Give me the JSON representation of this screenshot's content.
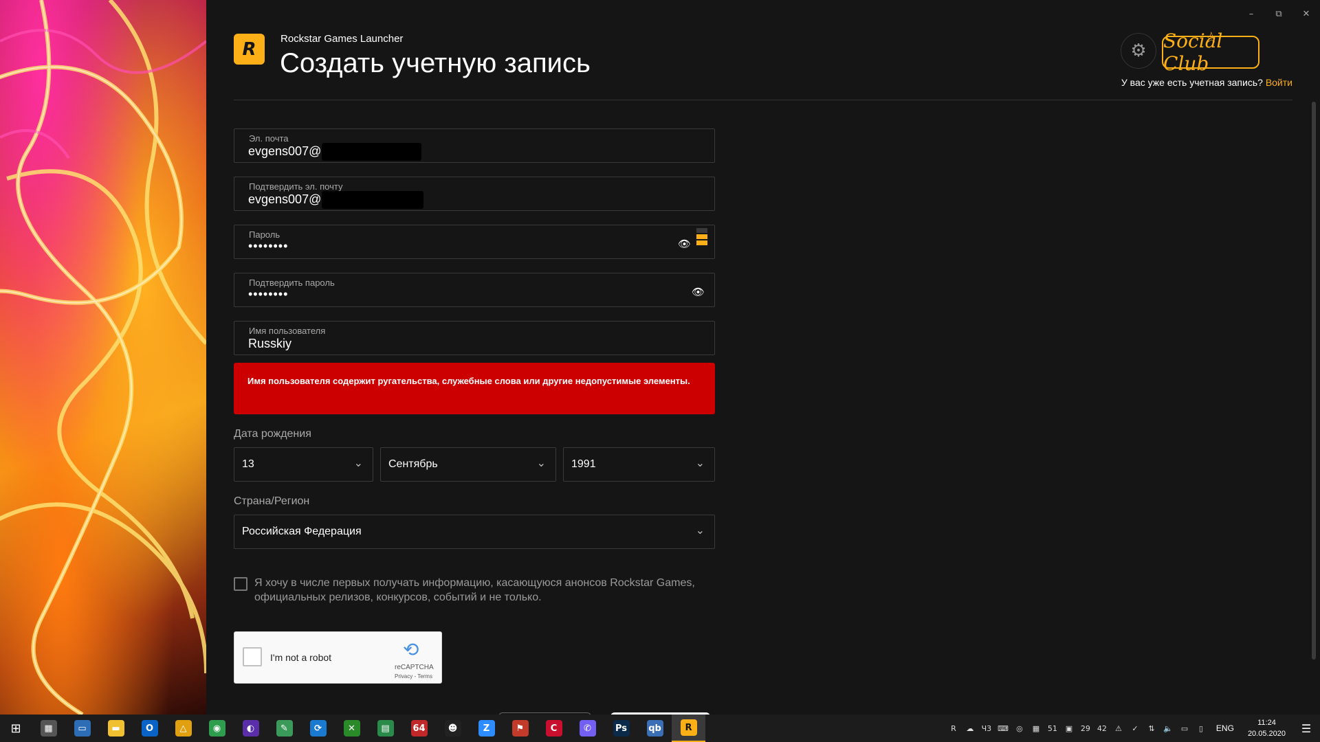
{
  "window": {
    "app_name": "Rockstar Games Launcher",
    "minimize_glyph": "–",
    "restore_glyph": "⧉",
    "close_glyph": "✕"
  },
  "header": {
    "logo_letter": "R",
    "title": "Создать учетную запись",
    "settings_icon": "⚙",
    "social_club_logo": "Social Club",
    "signin_prompt": "У вас уже есть учетная запись?",
    "signin_link": "Войти"
  },
  "form": {
    "email": {
      "label": "Эл. почта",
      "value": "evgens007@"
    },
    "confirm_email": {
      "label": "Подтвердить эл. почту",
      "value": "evgens007@"
    },
    "password": {
      "label": "Пароль",
      "value": "••••••••",
      "strength_level": 2,
      "strength_max": 3
    },
    "confirm_password": {
      "label": "Подтвердить пароль",
      "value": "••••••••"
    },
    "username": {
      "label": "Имя пользователя",
      "value": "Russkiy"
    },
    "error_message": "Имя пользователя содержит ругательства, служебные слова или другие недопустимые элементы.",
    "dob_label": "Дата рождения",
    "dob_day": "13",
    "dob_month": "Сентябрь",
    "dob_year": "1991",
    "country_label": "Страна/Регион",
    "country_value": "Российская Федерация",
    "newsletter_text": "Я хочу в числе первых получать информацию, касающуюся анонсов Rockstar Games, официальных релизов, конкурсов, событий и не только.",
    "newsletter_checked": false
  },
  "captcha": {
    "label": "I'm not a robot",
    "brand": "reCAPTCHA",
    "links": "Privacy - Terms"
  },
  "taskbar": {
    "pinned": [
      {
        "name": "calculator",
        "glyph": "▦",
        "color": "#555"
      },
      {
        "name": "remote-desktop",
        "glyph": "▭",
        "color": "#2d6db5"
      },
      {
        "name": "file-explorer",
        "glyph": "▬",
        "color": "#f0c030"
      },
      {
        "name": "outlook",
        "glyph": "O",
        "color": "#0a64c8"
      },
      {
        "name": "triangle-app",
        "glyph": "△",
        "color": "#e0a010"
      },
      {
        "name": "chrome",
        "glyph": "◉",
        "color": "#2e9e4e"
      },
      {
        "name": "purple-app",
        "glyph": "◐",
        "color": "#5a2ea8"
      },
      {
        "name": "paint-app",
        "glyph": "✎",
        "color": "#3a9a5a"
      },
      {
        "name": "sync-app",
        "glyph": "⟳",
        "color": "#1a7ad0"
      },
      {
        "name": "xbox",
        "glyph": "✕",
        "color": "#2a8a2a"
      },
      {
        "name": "green-app",
        "glyph": "▤",
        "color": "#2a8a4a"
      },
      {
        "name": "app-64",
        "glyph": "64",
        "color": "#c0282a"
      },
      {
        "name": "mask-app",
        "glyph": "☻",
        "color": "#222"
      },
      {
        "name": "zoom",
        "glyph": "Z",
        "color": "#2d8cff"
      },
      {
        "name": "filezilla",
        "glyph": "⚑",
        "color": "#c23a2a"
      },
      {
        "name": "red-c-app",
        "glyph": "C",
        "color": "#c8102e"
      },
      {
        "name": "viber",
        "glyph": "✆",
        "color": "#7360f2"
      },
      {
        "name": "photoshop",
        "glyph": "Ps",
        "color": "#0b2a4a"
      },
      {
        "name": "qbittorrent",
        "glyph": "qb",
        "color": "#3a6fb5"
      },
      {
        "name": "rockstar-launcher",
        "glyph": "R",
        "color": "#fcaf17"
      }
    ],
    "tray_labels": [
      "R",
      "☁",
      "Ч3",
      "⌨",
      "◎",
      "▦",
      "51",
      "▣",
      "29",
      "42",
      "⚠",
      "✓",
      "⇅",
      "🔈",
      "▭",
      "▯"
    ],
    "language": "ENG",
    "time": "11:24",
    "date": "20.05.2020",
    "notification_icon": "☰"
  },
  "colors": {
    "accent": "#fcaf17",
    "error": "#cc0000",
    "background": "#151515"
  }
}
